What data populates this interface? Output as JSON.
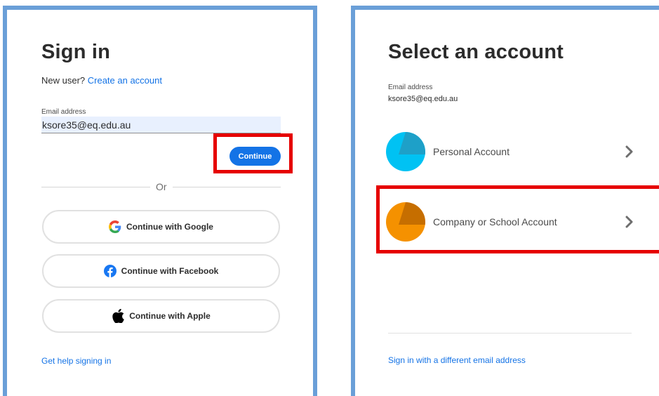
{
  "signin": {
    "title": "Sign in",
    "new_user_text": "New user? ",
    "create_account_link": "Create an account",
    "email_label": "Email address",
    "email_value": "ksore35@eq.edu.au",
    "continue_label": "Continue",
    "or_text": "Or",
    "google_label": "Continue with Google",
    "facebook_label": "Continue with Facebook",
    "apple_label": "Continue with Apple",
    "help_link": "Get help signing in"
  },
  "select_account": {
    "title": "Select an account",
    "email_label": "Email address",
    "email_value": "ksore35@eq.edu.au",
    "accounts": [
      {
        "label": "Personal Account",
        "color": "#00c2f3",
        "shade": "#1ea0c8"
      },
      {
        "label": "Company or School Account",
        "color": "#f59100",
        "shade": "#c66e00"
      }
    ],
    "different_email_link": "Sign in with a different email address"
  },
  "colors": {
    "accent": "#1473e6",
    "highlight": "#e60000",
    "frame": "#6a9fd8"
  }
}
